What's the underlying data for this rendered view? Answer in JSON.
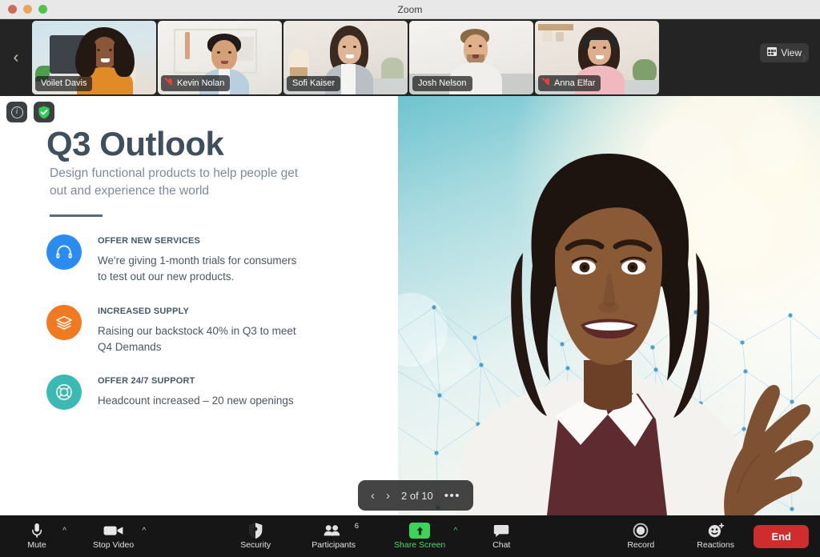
{
  "window": {
    "title": "Zoom",
    "controls": [
      "close",
      "minimize",
      "maximize"
    ]
  },
  "filmstrip": {
    "prev_arrow": "‹",
    "next_arrow": "›",
    "view_button": {
      "label": "View",
      "icon": "grid-view-icon"
    },
    "participants": [
      {
        "name": "Voilet Davis",
        "muted": false,
        "active_speaker": true
      },
      {
        "name": "Kevin Nolan",
        "muted": true,
        "active_speaker": false
      },
      {
        "name": "Sofi Kaiser",
        "muted": false,
        "active_speaker": false
      },
      {
        "name": "Josh Nelson",
        "muted": false,
        "active_speaker": false
      },
      {
        "name": "Anna Elfar",
        "muted": true,
        "active_speaker": false
      }
    ]
  },
  "stage": {
    "badges": [
      {
        "name": "meeting-info-icon",
        "glyph": "i"
      },
      {
        "name": "encryption-shield-icon",
        "glyph": "✓"
      }
    ],
    "slide": {
      "title": "Q3 Outlook",
      "subtitle": "Design functional products to help people get out and experience the world",
      "bullets": [
        {
          "heading": "OFFER NEW SERVICES",
          "text": "We're giving 1-month trials for consumers to test out our new products.",
          "icon": "headphones-icon",
          "color": "#2a8cf0"
        },
        {
          "heading": "INCREASED SUPPLY",
          "text": "Raising our backstock 40% in Q3 to meet Q4 Demands",
          "icon": "layers-icon",
          "color": "#f07a22"
        },
        {
          "heading": "OFFER 24/7 SUPPORT",
          "text": "Headcount increased – 20 new openings",
          "icon": "lifebuoy-icon",
          "color": "#3cb9b4"
        }
      ]
    },
    "slide_nav": {
      "prev": "‹",
      "next": "›",
      "position": "2 of 10",
      "more": "•••"
    }
  },
  "toolbar": {
    "items": [
      {
        "label": "Mute",
        "icon": "microphone-icon",
        "caret": true,
        "caret_green": false,
        "count": null
      },
      {
        "label": "Stop Video",
        "icon": "video-camera-icon",
        "caret": true,
        "caret_green": false,
        "count": null
      },
      {
        "label": "Security",
        "icon": "shield-icon",
        "caret": false,
        "caret_green": false,
        "count": null
      },
      {
        "label": "Participants",
        "icon": "people-icon",
        "caret": false,
        "caret_green": false,
        "count": "6"
      },
      {
        "label": "Share Screen",
        "icon": "share-up-arrow-icon",
        "caret": true,
        "caret_green": true,
        "count": null
      },
      {
        "label": "Chat",
        "icon": "chat-bubble-icon",
        "caret": false,
        "caret_green": false,
        "count": null
      },
      {
        "label": "Record",
        "icon": "record-circle-icon",
        "caret": false,
        "caret_green": false,
        "count": null
      },
      {
        "label": "Reactions",
        "icon": "reactions-smiley-icon",
        "caret": false,
        "caret_green": false,
        "count": null
      }
    ],
    "end_button": {
      "label": "End",
      "color": "#cf2d2d"
    }
  },
  "colors": {
    "share_green": "#3dd35b",
    "end_red": "#cf2d2d",
    "toolbar_bg": "#161616",
    "filmstrip_bg": "#242424",
    "slide_title": "#3f4f5e"
  }
}
